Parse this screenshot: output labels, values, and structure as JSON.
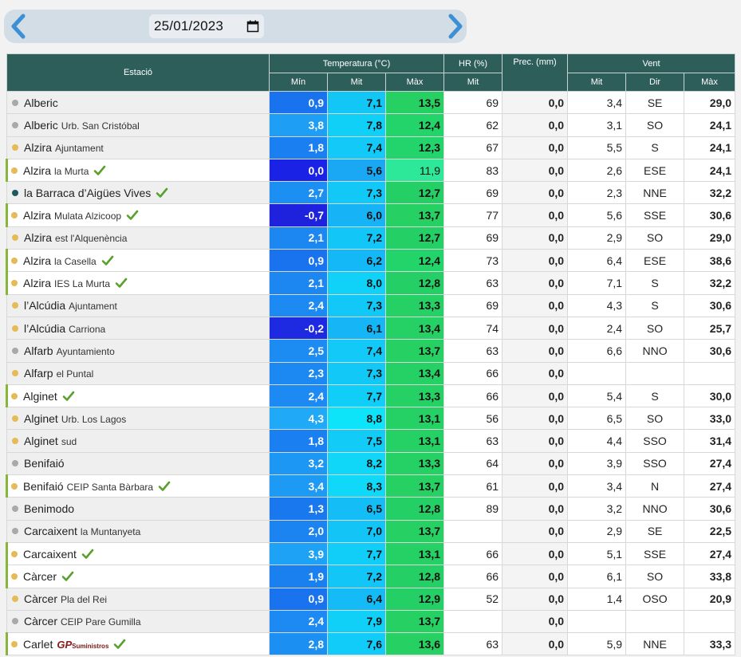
{
  "nav": {
    "date_value": "25/01/2023"
  },
  "headers": {
    "station": "Estació",
    "temperature": "Temperatura (°C)",
    "hr": "HR (%)",
    "prec": "Prec. (mm)",
    "wind": "Vent",
    "t_min": "Mín",
    "t_mit": "Mit",
    "t_max": "Màx",
    "hr_mit": "Mit",
    "w_mit": "Mit",
    "w_dir": "Dir",
    "w_max": "Màx"
  },
  "colors": {
    "header_bg": "#2e5e5a",
    "dot_yellow": "#e6bb55",
    "dot_grey": "#a9a9a9",
    "dot_teal": "#1d5a60",
    "check_green": "#5aa02c"
  },
  "rows": [
    {
      "name": "Alberic",
      "sub": "",
      "dot": "grey",
      "check": false,
      "hl": false,
      "min": "0,9",
      "mit": "7,1",
      "max": "13,5",
      "hr": "69",
      "prec": "0,0",
      "wmit": "3,4",
      "wdir": "SE",
      "wmax": "29,0",
      "c": [
        "#1a73ee",
        "#12c6f6",
        "#26d063"
      ]
    },
    {
      "name": "Alberic",
      "sub": "Urb. San Cristóbal",
      "dot": "grey",
      "check": false,
      "hl": false,
      "min": "3,8",
      "mit": "7,8",
      "max": "12,4",
      "hr": "62",
      "prec": "0,0",
      "wmit": "3,1",
      "wdir": "SO",
      "wmax": "24,1",
      "c": [
        "#1e9ff5",
        "#10d0f8",
        "#22d46a"
      ]
    },
    {
      "name": "Alzira",
      "sub": "Ajuntament",
      "dot": "yellow",
      "check": false,
      "hl": false,
      "min": "1,8",
      "mit": "7,4",
      "max": "12,3",
      "hr": "67",
      "prec": "0,0",
      "wmit": "5,5",
      "wdir": "S",
      "wmax": "24,1",
      "c": [
        "#1a7ff0",
        "#12c9f7",
        "#22d46b"
      ]
    },
    {
      "name": "Alzira",
      "sub": "la Murta",
      "dot": "yellow",
      "check": true,
      "hl": true,
      "min": "0,0",
      "mit": "5,6",
      "max": "11,9",
      "hr": "83",
      "prec": "0,0",
      "wmit": "2,6",
      "wdir": "ESE",
      "wmax": "24,1",
      "c": [
        "#1a22e6",
        "#1aa8f4",
        "#2ee89a"
      ]
    },
    {
      "name": "la Barraca d’Aigües Vives",
      "sub": "",
      "dot": "teal",
      "check": true,
      "hl": false,
      "min": "2,7",
      "mit": "7,3",
      "max": "12,7",
      "hr": "69",
      "prec": "0,0",
      "wmit": "2,3",
      "wdir": "NNE",
      "wmax": "32,2",
      "c": [
        "#1c8ff2",
        "#12c8f7",
        "#24d066"
      ]
    },
    {
      "name": "Alzira",
      "sub": "Mulata Alzicoop",
      "dot": "yellow",
      "check": true,
      "hl": true,
      "min": "-0,7",
      "mit": "6,0",
      "max": "13,7",
      "hr": "77",
      "prec": "0,0",
      "wmit": "5,6",
      "wdir": "SSE",
      "wmax": "30,6",
      "c": [
        "#1e22dc",
        "#16b4f6",
        "#26d063"
      ]
    },
    {
      "name": "Alzira",
      "sub": "est l'Alquenència",
      "dot": "yellow",
      "check": false,
      "hl": false,
      "min": "2,1",
      "mit": "7,2",
      "max": "12,7",
      "hr": "69",
      "prec": "0,0",
      "wmit": "2,9",
      "wdir": "SO",
      "wmax": "29,0",
      "c": [
        "#1c86f1",
        "#12c6f7",
        "#24d066"
      ]
    },
    {
      "name": "Alzira",
      "sub": "la Casella",
      "dot": "yellow",
      "check": true,
      "hl": true,
      "min": "0,9",
      "mit": "6,2",
      "max": "12,4",
      "hr": "73",
      "prec": "0,0",
      "wmit": "6,4",
      "wdir": "ESE",
      "wmax": "38,6",
      "c": [
        "#1a73ee",
        "#15b8f6",
        "#22d46a"
      ]
    },
    {
      "name": "Alzira",
      "sub": "IES La Murta",
      "dot": "yellow",
      "check": true,
      "hl": true,
      "min": "2,1",
      "mit": "8,0",
      "max": "12,8",
      "hr": "63",
      "prec": "0,0",
      "wmit": "7,1",
      "wdir": "S",
      "wmax": "32,2",
      "c": [
        "#1c86f1",
        "#10d2f8",
        "#24d066"
      ]
    },
    {
      "name": "l’Alcúdia",
      "sub": "Ajuntament",
      "dot": "yellow",
      "check": false,
      "hl": false,
      "min": "2,4",
      "mit": "7,3",
      "max": "13,3",
      "hr": "69",
      "prec": "0,0",
      "wmit": "4,3",
      "wdir": "S",
      "wmax": "30,6",
      "c": [
        "#1c8af2",
        "#12c8f7",
        "#25d064"
      ]
    },
    {
      "name": "l’Alcúdia",
      "sub": "Carriona",
      "dot": "yellow",
      "check": false,
      "hl": false,
      "min": "-0,2",
      "mit": "6,1",
      "max": "13,4",
      "hr": "74",
      "prec": "0,0",
      "wmit": "2,4",
      "wdir": "SO",
      "wmax": "25,7",
      "c": [
        "#1e2ae2",
        "#16b6f6",
        "#25d064"
      ]
    },
    {
      "name": "Alfarb",
      "sub": "Ayuntamiento",
      "dot": "grey",
      "check": false,
      "hl": false,
      "min": "2,5",
      "mit": "7,4",
      "max": "13,7",
      "hr": "63",
      "prec": "0,0",
      "wmit": "6,6",
      "wdir": "NNO",
      "wmax": "30,6",
      "c": [
        "#1c8cf2",
        "#12c9f7",
        "#26d063"
      ]
    },
    {
      "name": "Alfarp",
      "sub": "el Puntal",
      "dot": "yellow",
      "check": false,
      "hl": false,
      "min": "2,3",
      "mit": "7,3",
      "max": "13,4",
      "hr": "66",
      "prec": "0,0",
      "wmit": "",
      "wdir": "",
      "wmax": "",
      "c": [
        "#1c88f1",
        "#12c8f7",
        "#25d064"
      ]
    },
    {
      "name": "Alginet",
      "sub": "",
      "dot": "yellow",
      "check": true,
      "hl": true,
      "min": "2,4",
      "mit": "7,7",
      "max": "13,3",
      "hr": "66",
      "prec": "0,0",
      "wmit": "5,4",
      "wdir": "S",
      "wmax": "30,0",
      "c": [
        "#1c8af2",
        "#10cef8",
        "#25d064"
      ]
    },
    {
      "name": "Alginet",
      "sub": "Urb. Los Lagos",
      "dot": "yellow",
      "check": false,
      "hl": false,
      "min": "4,3",
      "mit": "8,8",
      "max": "13,1",
      "hr": "56",
      "prec": "0,0",
      "wmit": "6,5",
      "wdir": "SO",
      "wmax": "33,0",
      "c": [
        "#1fa9f6",
        "#0ee4f9",
        "#25d064"
      ]
    },
    {
      "name": "Alginet",
      "sub": "sud",
      "dot": "yellow",
      "check": false,
      "hl": false,
      "min": "1,8",
      "mit": "7,5",
      "max": "13,1",
      "hr": "63",
      "prec": "0,0",
      "wmit": "4,4",
      "wdir": "SSO",
      "wmax": "31,4",
      "c": [
        "#1a7ff0",
        "#12cbf7",
        "#25d064"
      ]
    },
    {
      "name": "Benifaió",
      "sub": "",
      "dot": "grey",
      "check": false,
      "hl": false,
      "min": "3,2",
      "mit": "8,2",
      "max": "13,3",
      "hr": "64",
      "prec": "0,0",
      "wmit": "3,9",
      "wdir": "SSO",
      "wmax": "27,4",
      "c": [
        "#1d97f4",
        "#10d6f8",
        "#25d064"
      ]
    },
    {
      "name": "Benifaió",
      "sub": "CEIP Santa Bàrbara",
      "dot": "yellow",
      "check": true,
      "hl": true,
      "min": "3,4",
      "mit": "8,3",
      "max": "13,7",
      "hr": "61",
      "prec": "0,0",
      "wmit": "3,4",
      "wdir": "N",
      "wmax": "27,4",
      "c": [
        "#1d9af4",
        "#10d8f8",
        "#26d063"
      ]
    },
    {
      "name": "Benimodo",
      "sub": "",
      "dot": "grey",
      "check": false,
      "hl": false,
      "min": "1,3",
      "mit": "6,5",
      "max": "12,8",
      "hr": "89",
      "prec": "0,0",
      "wmit": "3,2",
      "wdir": "NNO",
      "wmax": "30,6",
      "c": [
        "#1a78ef",
        "#14bdf6",
        "#24d066"
      ]
    },
    {
      "name": "Carcaixent",
      "sub": "la Muntanyeta",
      "dot": "grey",
      "check": false,
      "hl": false,
      "min": "2,0",
      "mit": "7,0",
      "max": "13,7",
      "hr": "",
      "prec": "0,0",
      "wmit": "2,9",
      "wdir": "SE",
      "wmax": "22,5",
      "c": [
        "#1c84f0",
        "#13c4f7",
        "#26d063"
      ]
    },
    {
      "name": "Carcaixent",
      "sub": "",
      "dot": "yellow",
      "check": true,
      "hl": true,
      "min": "3,9",
      "mit": "7,7",
      "max": "13,1",
      "hr": "66",
      "prec": "0,0",
      "wmit": "5,1",
      "wdir": "SSE",
      "wmax": "27,4",
      "c": [
        "#1ea2f5",
        "#10cef8",
        "#25d064"
      ]
    },
    {
      "name": "Càrcer",
      "sub": "",
      "dot": "yellow",
      "check": true,
      "hl": true,
      "min": "1,9",
      "mit": "7,2",
      "max": "12,8",
      "hr": "66",
      "prec": "0,0",
      "wmit": "6,1",
      "wdir": "SO",
      "wmax": "33,8",
      "c": [
        "#1a80f0",
        "#12c6f7",
        "#24d066"
      ]
    },
    {
      "name": "Càrcer",
      "sub": "Pla del Rei",
      "dot": "yellow",
      "check": false,
      "hl": false,
      "min": "0,9",
      "mit": "6,4",
      "max": "12,9",
      "hr": "52",
      "prec": "0,0",
      "wmit": "1,4",
      "wdir": "OSO",
      "wmax": "20,9",
      "c": [
        "#1a73ee",
        "#14bbf6",
        "#24d066"
      ]
    },
    {
      "name": "Càrcer",
      "sub": "CEIP Pare Gumilla",
      "dot": "grey",
      "check": false,
      "hl": false,
      "min": "2,4",
      "mit": "7,9",
      "max": "13,7",
      "hr": "",
      "prec": "0,0",
      "wmit": "",
      "wdir": "",
      "wmax": "",
      "c": [
        "#1c8af2",
        "#10d0f8",
        "#26d063"
      ]
    },
    {
      "name": "Carlet",
      "sub": "",
      "dot": "yellow",
      "check": true,
      "hl": true,
      "gp": true,
      "gp_main": "GP",
      "gp_small": "Suministros",
      "min": "2,8",
      "mit": "7,6",
      "max": "13,6",
      "hr": "63",
      "prec": "0,0",
      "wmit": "5,9",
      "wdir": "NNE",
      "wmax": "33,3",
      "c": [
        "#1c90f2",
        "#11ccf8",
        "#26d063"
      ]
    }
  ]
}
